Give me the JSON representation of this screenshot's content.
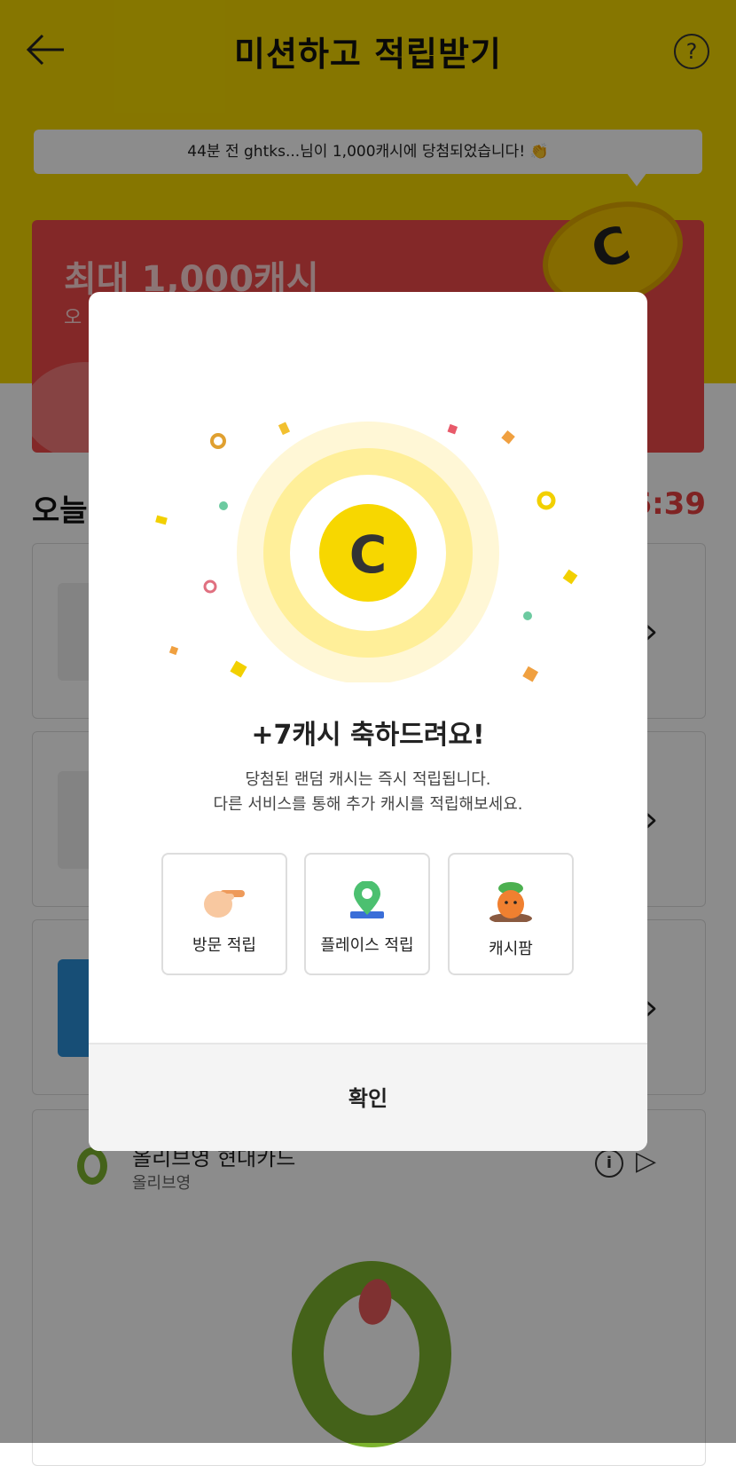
{
  "header": {
    "title": "미션하고 적립받기",
    "back_label": "←",
    "help_label": "?"
  },
  "ticker": {
    "text": "44분 전 ghtks...님이 1,000캐시에 당첨되었습니다! 👏"
  },
  "promo": {
    "title": "최대 1,000캐시",
    "subtitle": "오",
    "coin_letter": "C"
  },
  "today": {
    "title": "오늘",
    "timer": "6:39"
  },
  "cards": [
    {
      "chevron": "›"
    },
    {
      "chevron": "›"
    },
    {
      "chevron": "›"
    }
  ],
  "bottom_card": {
    "title": "올리브영 현대카드",
    "subtitle": "올리브영",
    "info_label": "i",
    "play_label": "▷"
  },
  "modal": {
    "coin_letter": "C",
    "heading": "+7캐시 축하드려요!",
    "desc_line1": "당첨된 랜덤 캐시는 즉시 적립됩니다.",
    "desc_line2": "다른 서비스를 통해 추가 캐시를 적립해보세요.",
    "options": [
      {
        "label": "방문 적립",
        "icon": "pointing-hand-icon"
      },
      {
        "label": "플레이스 적립",
        "icon": "map-pin-icon"
      },
      {
        "label": "캐시팜",
        "icon": "carrot-icon"
      }
    ],
    "confirm_label": "확인"
  },
  "colors": {
    "header_bg": "#f4d800",
    "promo_bg": "#ee4a4a",
    "coin_yellow": "#f7d700",
    "timer_red": "#e84040"
  }
}
